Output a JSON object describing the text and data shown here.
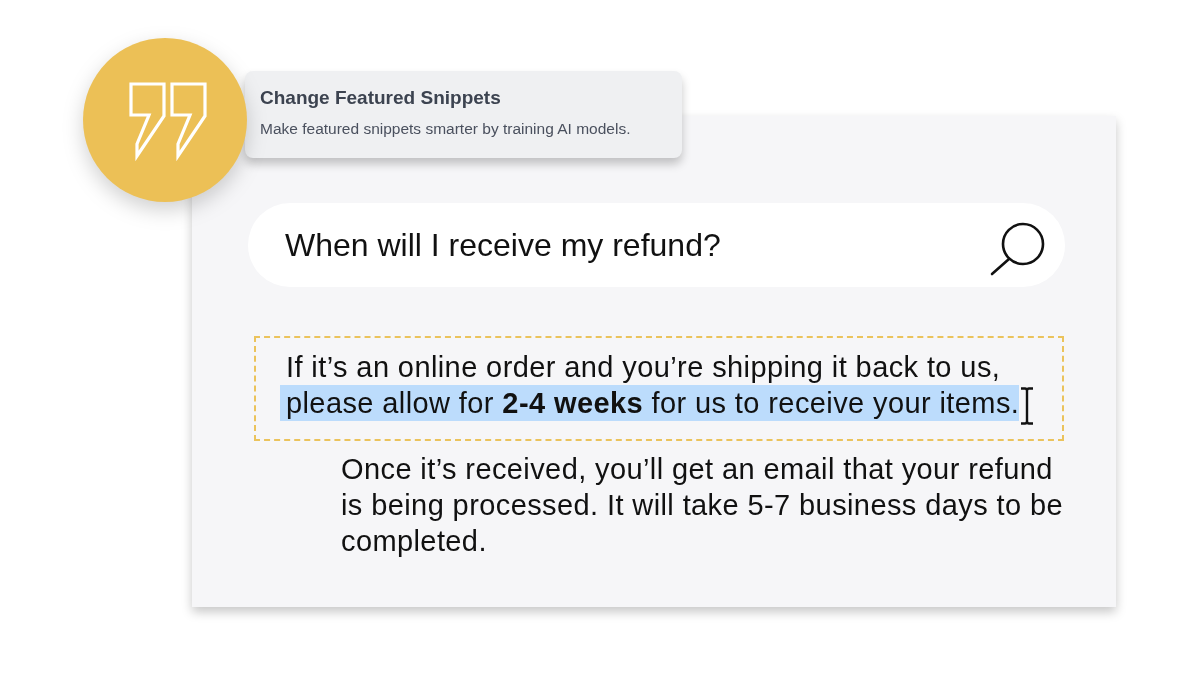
{
  "tooltip": {
    "title": "Change Featured Snippets",
    "description": "Make featured snippets smarter by training AI models."
  },
  "search": {
    "value": "When will I receive my refund?"
  },
  "featured_snippet": {
    "segments": [
      {
        "text": "If it’s an online order and you’re shipping it back to us,",
        "selected": false
      },
      {
        "text": "please allow for **2-4 weeks** for us to receive your items.",
        "selected": true
      }
    ]
  },
  "answer_text": "Once it’s received, you’ll get an email that your refund is being processed. It will take 5-7 business days to be completed."
}
